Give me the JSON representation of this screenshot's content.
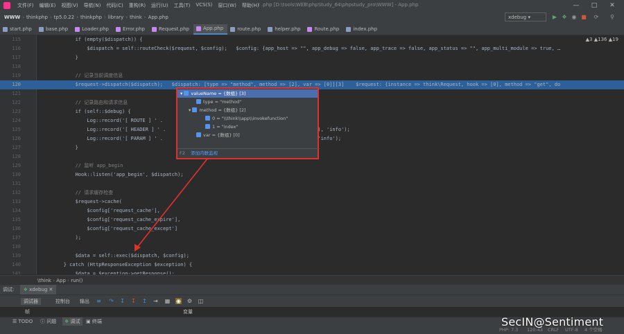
{
  "menubar": {
    "items": [
      "文件(F)",
      "编辑(E)",
      "视图(V)",
      "导航(N)",
      "代码(C)",
      "重构(R)",
      "运行(U)",
      "工具(T)",
      "VCS(S)",
      "窗口(W)",
      "帮助(H)"
    ],
    "window_title": "! .php [D:\\tools\\WEB\\phpStudy_64\\phpstudy_pro\\WWW] - App.php"
  },
  "navbar": {
    "root": "WWW",
    "crumbs": [
      "thinkphp",
      "tp5.0.22",
      "thinkphp",
      "library",
      "think",
      "App.php"
    ],
    "run_config": "xdebug"
  },
  "tabs": [
    {
      "label": "start.php",
      "color": "#8a9fbf"
    },
    {
      "label": "base.php",
      "color": "#8a9fbf"
    },
    {
      "label": "Loader.php",
      "color": "#c48af0"
    },
    {
      "label": "Error.php",
      "color": "#c48af0"
    },
    {
      "label": "Request.php",
      "color": "#c48af0"
    },
    {
      "label": "App.php",
      "color": "#c48af0",
      "active": true
    },
    {
      "label": "route.php",
      "color": "#8a9fbf"
    },
    {
      "label": "helper.php",
      "color": "#8a9fbf"
    },
    {
      "label": "Route.php",
      "color": "#c48af0"
    },
    {
      "label": "index.php",
      "color": "#8a9fbf"
    }
  ],
  "editor": {
    "warnings": "▲3 ▲136 ▲19",
    "lines": [
      {
        "n": "115",
        "t": "            if (empty($dispatch)) {"
      },
      {
        "n": "116",
        "t": "                $dispatch = self::routeCheck($request, $config);   $config: {app_host => \"\", app_debug => false, app_trace => false, app_status => \"\", app_multi_module => true, …"
      },
      {
        "n": "117",
        "t": "            }"
      },
      {
        "n": "118",
        "t": ""
      },
      {
        "n": "119",
        "t": "            // 记录当前调度信息"
      },
      {
        "n": "120",
        "t": "            $request->dispatch($dispatch);   $dispatch: [type => \"method\", method => [2], var => [0]][3]    $request: {instance => think\\Request, hook => [0], method => \"get\", do"
      },
      {
        "n": "121",
        "t": ""
      },
      {
        "n": "122",
        "t": "            // 记录路由和请求信息"
      },
      {
        "n": "123",
        "t": "            if (self::$debug) {"
      },
      {
        "n": "124",
        "t": "                Log::record('[ ROUTE ] ' ."
      },
      {
        "n": "125",
        "t": "                Log::record('[ HEADER ] ' .                                                    ), 'info');"
      },
      {
        "n": "126",
        "t": "                Log::record('[ PARAM ] ' .                                                     'info');"
      },
      {
        "n": "127",
        "t": "            }"
      },
      {
        "n": "128",
        "t": ""
      },
      {
        "n": "129",
        "t": "            // 监听 app_begin"
      },
      {
        "n": "130",
        "t": "            Hook::listen('app_begin', $dispatch);"
      },
      {
        "n": "131",
        "t": ""
      },
      {
        "n": "132",
        "t": "            // 请求缓存检查"
      },
      {
        "n": "133",
        "t": "            $request->cache("
      },
      {
        "n": "134",
        "t": "                $config['request_cache'],"
      },
      {
        "n": "135",
        "t": "                $config['request_cache_expire'],"
      },
      {
        "n": "136",
        "t": "                $config['request_cache_except']"
      },
      {
        "n": "137",
        "t": "            );"
      },
      {
        "n": "138",
        "t": ""
      },
      {
        "n": "139",
        "t": "            $data = self::exec($dispatch, $config);"
      },
      {
        "n": "140",
        "t": "        } catch (HttpResponseException $exception) {"
      },
      {
        "n": "141",
        "t": "            $data = $exception->getResponse();"
      }
    ]
  },
  "popup": {
    "rows": [
      "valueName = {数组} [3]",
      "type = \"method\"",
      "method = {数组} [2]",
      "0 = \"\\\\think\\\\app\\\\invokefunction\"",
      "1 = \"index\"",
      "var = {数组} [0]"
    ],
    "footer_key": "F2",
    "footer_link": "添加内联监视"
  },
  "breadcrumb2": [
    "\\think",
    "App",
    "run()"
  ],
  "debug": {
    "label": "调试:",
    "session": "xdebug",
    "tabs": [
      "调试器",
      "控制台",
      "输出"
    ],
    "frames_header": "帧",
    "vars_header": "变量"
  },
  "bottom_tools": [
    "TODO",
    "问题",
    "调试",
    "终端"
  ],
  "status": {
    "php": "PHP: 7.3",
    "pos": "120:43",
    "crlf": "CRLF",
    "enc": "UTF-8",
    "indent": "4 个空格"
  },
  "watermark": "SecIN@Sentiment",
  "colors": {
    "highlight": "#2d6099",
    "popup_border": "#e0322c",
    "selection": "#4b6eaf",
    "arrow": "#e0322c"
  }
}
